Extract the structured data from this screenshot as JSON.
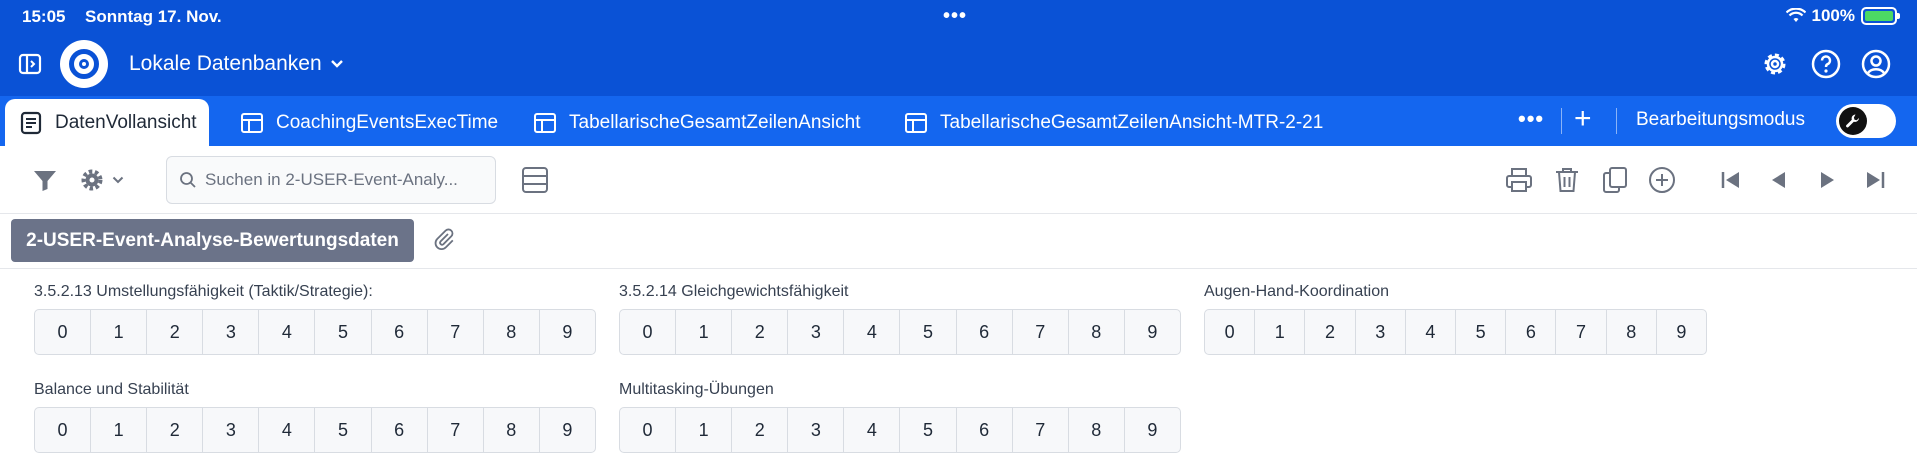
{
  "status_bar": {
    "time": "15:05",
    "date": "Sonntag 17. Nov.",
    "battery": "100%"
  },
  "header": {
    "title": "Lokale Datenbanken"
  },
  "tabs": [
    {
      "label": "DatenVollansicht",
      "active": true
    },
    {
      "label": "CoachingEventsExecTime"
    },
    {
      "label": "TabellarischeGesamtZeilenAnsicht"
    },
    {
      "label": "TabellarischeGesamtZeilenAnsicht-MTR-2-21"
    }
  ],
  "tabbar": {
    "mode_label": "Bearbeitungsmodus",
    "mode_on": false
  },
  "search": {
    "placeholder": "Suchen in 2-USER-Event-Analy..."
  },
  "record": {
    "title": "2-USER-Event-Analyse-Bewertungsdaten"
  },
  "rating_groups": [
    {
      "label": "3.5.2.13 Umstellungsfähigkeit (Taktik/Strategie):",
      "options": [
        "0",
        "1",
        "2",
        "3",
        "4",
        "5",
        "6",
        "7",
        "8",
        "9"
      ]
    },
    {
      "label": "3.5.2.14 Gleichgewichtsfähigkeit",
      "options": [
        "0",
        "1",
        "2",
        "3",
        "4",
        "5",
        "6",
        "7",
        "8",
        "9"
      ]
    },
    {
      "label": "Augen-Hand-Koordination",
      "options": [
        "0",
        "1",
        "2",
        "3",
        "4",
        "5",
        "6",
        "7",
        "8",
        "9"
      ]
    },
    {
      "label": "Balance und Stabilität",
      "options": [
        "0",
        "1",
        "2",
        "3",
        "4",
        "5",
        "6",
        "7",
        "8",
        "9"
      ]
    },
    {
      "label": "Multitasking-Übungen",
      "options": [
        "0",
        "1",
        "2",
        "3",
        "4",
        "5",
        "6",
        "7",
        "8",
        "9"
      ]
    }
  ],
  "colors": {
    "header_bg": "#0a52d6",
    "tabbar_bg": "#1466ef",
    "record_btn": "#6b7389"
  }
}
